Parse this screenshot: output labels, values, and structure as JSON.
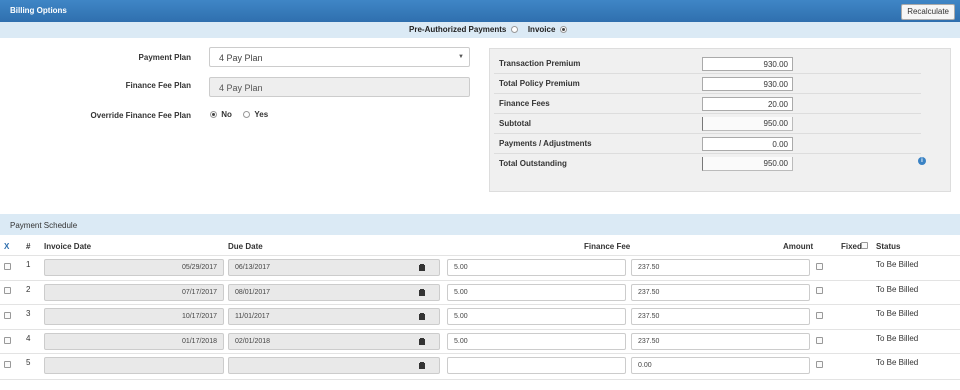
{
  "header": {
    "title": "Billing Options",
    "recalculate_label": "Recalculate"
  },
  "payment_options": {
    "preauth_label": "Pre-Authorized Payments",
    "invoice_label": "Invoice",
    "selected": "Invoice"
  },
  "form": {
    "payment_plan_label": "Payment Plan",
    "payment_plan_value": "4 Pay Plan",
    "finance_fee_plan_label": "Finance Fee Plan",
    "finance_fee_plan_value": "4 Pay Plan",
    "override_label": "Override Finance Fee Plan",
    "override_no": "No",
    "override_yes": "Yes",
    "override_selected": "No"
  },
  "summary": [
    {
      "label": "Transaction Premium",
      "value": "930.00"
    },
    {
      "label": "Total Policy Premium",
      "value": "930.00"
    },
    {
      "label": "Finance Fees",
      "value": "20.00"
    },
    {
      "label": "Subtotal",
      "value": "950.00"
    },
    {
      "label": "Payments / Adjustments",
      "value": "0.00"
    },
    {
      "label": "Total Outstanding",
      "value": "950.00"
    }
  ],
  "info_icon": "info-icon",
  "schedule": {
    "title": "Payment Schedule",
    "columns": {
      "x": "X",
      "num": "#",
      "invoice_date": "Invoice Date",
      "due_date": "Due Date",
      "finance_fee": "Finance Fee",
      "amount": "Amount",
      "fixed": "Fixed",
      "status": "Status"
    },
    "rows": [
      {
        "num": "1",
        "invoice_date": "05/29/2017",
        "due_date": "06/13/2017",
        "finance_fee": "5.00",
        "amount": "237.50",
        "status": "To Be Billed"
      },
      {
        "num": "2",
        "invoice_date": "07/17/2017",
        "due_date": "08/01/2017",
        "finance_fee": "5.00",
        "amount": "237.50",
        "status": "To Be Billed"
      },
      {
        "num": "3",
        "invoice_date": "10/17/2017",
        "due_date": "11/01/2017",
        "finance_fee": "5.00",
        "amount": "237.50",
        "status": "To Be Billed"
      },
      {
        "num": "4",
        "invoice_date": "01/17/2018",
        "due_date": "02/01/2018",
        "finance_fee": "5.00",
        "amount": "237.50",
        "status": "To Be Billed"
      },
      {
        "num": "5",
        "invoice_date": "",
        "due_date": "",
        "finance_fee": "",
        "amount": "0.00",
        "status": "To Be Billed"
      }
    ]
  },
  "colors": {
    "header_blue": "#2f6fae",
    "band_blue": "#dbeaf5",
    "info_blue": "#3a82c4"
  }
}
